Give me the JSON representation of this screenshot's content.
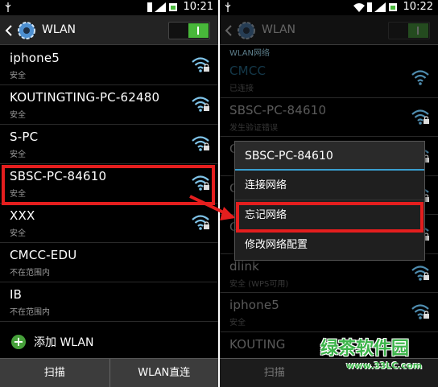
{
  "left": {
    "status_time": "10:21",
    "title": "WLAN",
    "networks": [
      {
        "name": "iphone5",
        "sub": "安全"
      },
      {
        "name": "KOUTINGTING-PC-62480",
        "sub": "安全"
      },
      {
        "name": "S-PC",
        "sub": "安全"
      },
      {
        "name": "SBSC-PC-84610",
        "sub": "安全"
      },
      {
        "name": "XXX",
        "sub": "安全"
      },
      {
        "name": "CMCC-EDU",
        "sub": "不在范围内"
      },
      {
        "name": "IB",
        "sub": "不在范围内"
      }
    ],
    "add_label": "添加 WLAN",
    "scan_label": "扫描",
    "direct_label": "WLAN直连"
  },
  "right": {
    "status_time": "10:22",
    "title": "WLAN",
    "section_label": "WLAN网络",
    "networks": [
      {
        "name": "CMCC",
        "sub": "已连接"
      },
      {
        "name": "SBSC-PC-84610",
        "sub": "发生验证错误"
      },
      {
        "name": "C",
        "sub": ""
      },
      {
        "name": "C",
        "sub": ""
      },
      {
        "name": "C",
        "sub": ""
      },
      {
        "name": "dlink",
        "sub": "安全 (WPS可用)"
      },
      {
        "name": "iphone5",
        "sub": "安全"
      },
      {
        "name": "KOUTING",
        "sub": ""
      }
    ],
    "scan_label": "扫描"
  },
  "dialog": {
    "title": "SBSC-PC-84610",
    "items": [
      "连接网络",
      "忘记网络",
      "修改网络配置"
    ]
  },
  "watermark": {
    "text": "绿茶软件园",
    "url": "www.33LC.com"
  },
  "colors": {
    "highlight": "#e41e1e",
    "accent": "#3aa0d0",
    "toggle_on": "#48b83a"
  }
}
